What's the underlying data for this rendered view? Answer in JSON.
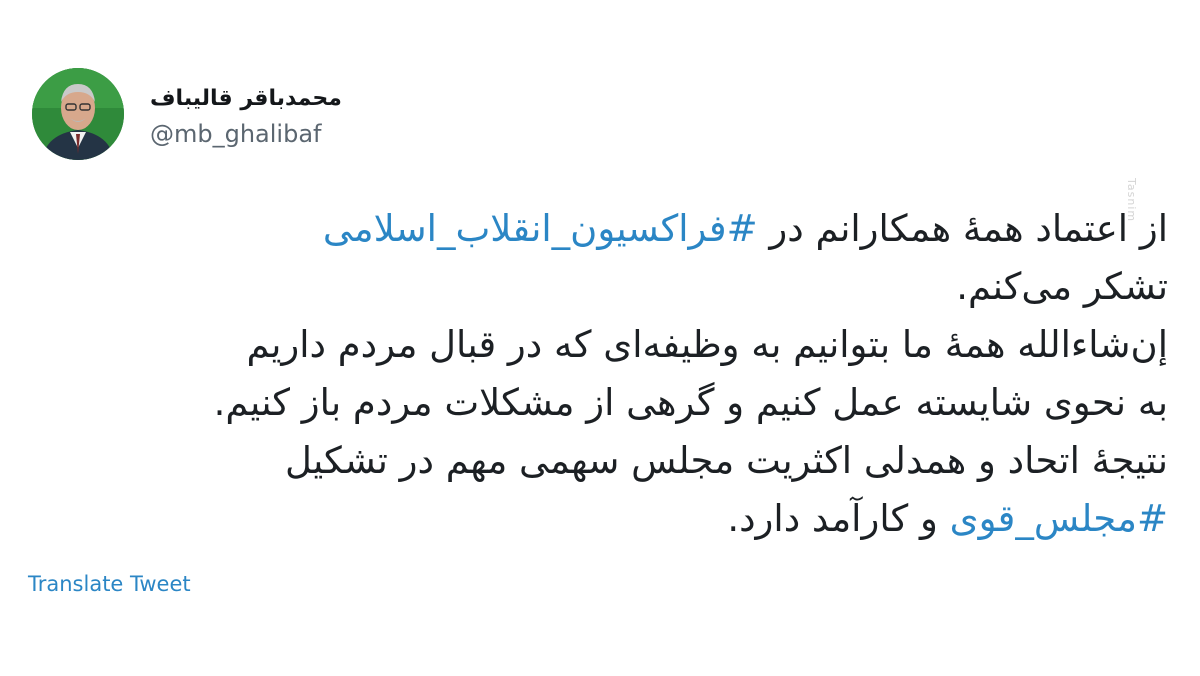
{
  "author": {
    "display_name": "محمدباقر قالیباف",
    "handle": "@mb_ghalibaf"
  },
  "tweet": {
    "line1_text": "از اعتماد همهٔ همکارانم در ",
    "line1_hashtag": "#فراکسیون_انقلاب_اسلامی",
    "line2": "تشکر می‌کنم.",
    "line3": "إن‌شاءالله همهٔ ما بتوانیم به وظیفه‌ای که در قبال مردم داریم",
    "line4": "به نحوی شایسته عمل کنیم و گرهی از مشکلات مردم باز کنیم.",
    "line5": "نتیجهٔ اتحاد و همدلی اکثریت مجلس سهمی مهم در تشکیل",
    "line6_hashtag": "#مجلس_قوی",
    "line6_text": " و کارآمد دارد."
  },
  "translate_label": "Translate Tweet",
  "watermark": "Tasnim",
  "colors": {
    "hashtag": "#2b86c5",
    "avatar_background": "#2f8a3a"
  }
}
